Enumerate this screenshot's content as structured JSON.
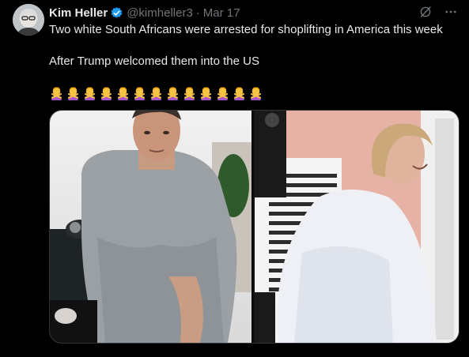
{
  "author": {
    "name": "Kim Heller",
    "handle": "@kimheller3",
    "separator": "·",
    "date": "Mar 17"
  },
  "tweet": {
    "line1": "Two white South Africans were arrested for shoplifting in America this week",
    "line2": "After Trump welcomed them into the US",
    "emoji_count": 13,
    "emoji_name": "person-gesturing-no"
  },
  "icons": {
    "verified": "verified-badge-icon",
    "grok": "grok-icon",
    "more": "more-icon"
  },
  "media": {
    "left": "photo of man in grey t-shirt being arrested",
    "right": "photo of woman in white shirt with police officer"
  },
  "colors": {
    "background": "#000000",
    "text": "#e7e9ea",
    "muted": "#71767b",
    "verified": "#1d9bf0",
    "border": "#2f3336"
  }
}
